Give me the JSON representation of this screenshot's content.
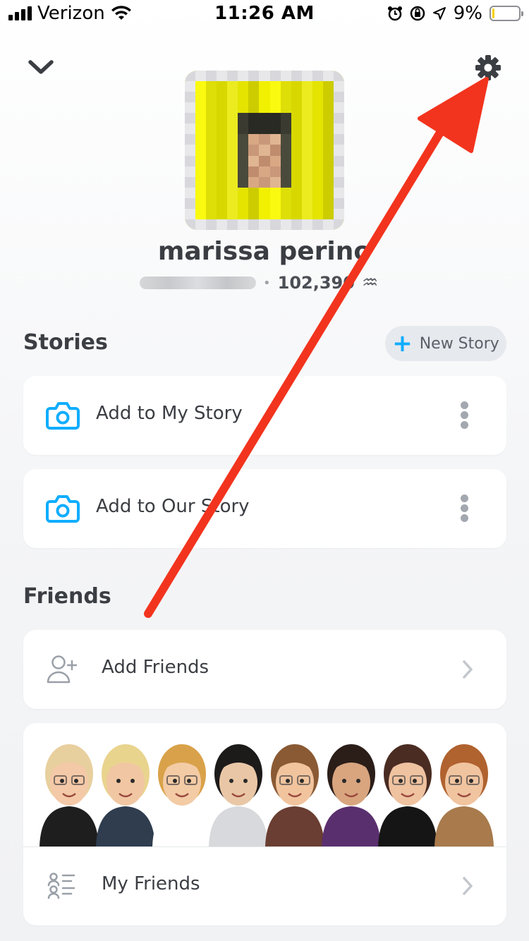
{
  "status_bar": {
    "carrier": "Verizon",
    "time": "11:26 AM",
    "battery_percent": "9%",
    "battery_level": 0.09,
    "icons": [
      "signal-icon",
      "wifi-icon",
      "alarm-icon",
      "orientation-lock-icon",
      "location-icon",
      "battery-icon"
    ]
  },
  "header": {
    "back_icon": "chevron-down-icon",
    "settings_icon": "gear-icon"
  },
  "profile": {
    "display_name": "marissa perino",
    "score": "102,390",
    "zodiac_symbol": "♒"
  },
  "stories": {
    "title": "Stories",
    "new_story_label": "New Story",
    "items": [
      {
        "label": "Add to My Story",
        "icon": "camera-icon"
      },
      {
        "label": "Add to Our Story",
        "icon": "camera-icon"
      }
    ]
  },
  "friends": {
    "title": "Friends",
    "add_friends_label": "Add Friends",
    "my_friends_label": "My Friends"
  },
  "colors": {
    "accent_blue": "#0fadff",
    "annotation_red": "#f2341e",
    "text_dark": "#3b3e43"
  }
}
